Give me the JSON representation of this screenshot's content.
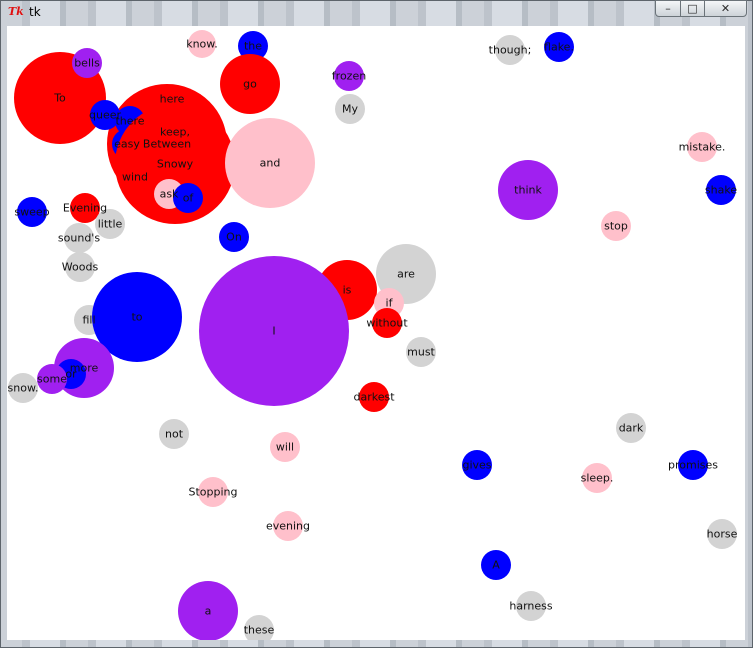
{
  "window": {
    "title": "tk",
    "logo": "Tk",
    "controls": {
      "minimize": "–",
      "maximize": "□",
      "close": "✕"
    }
  },
  "colors": {
    "red": "#ff0000",
    "blue": "#0000ff",
    "purple": "#a020f0",
    "pink": "#ffc0cb",
    "gray": "#d3d3d3"
  },
  "bubbles": [
    {
      "word": "To",
      "color": "red"
    },
    {
      "word": "bells",
      "color": "purple"
    },
    {
      "word": "know.",
      "color": "pink"
    },
    {
      "word": "the",
      "color": "blue"
    },
    {
      "word": "go",
      "color": "red"
    },
    {
      "word": "frozen",
      "color": "purple"
    },
    {
      "word": "My",
      "color": "gray"
    },
    {
      "word": "though;",
      "color": "gray"
    },
    {
      "word": "flake.",
      "color": "blue"
    },
    {
      "word": "here",
      "color": "gray"
    },
    {
      "word": "Between",
      "color": "red"
    },
    {
      "word": "there",
      "color": "blue"
    },
    {
      "word": "keep,",
      "color": "purple"
    },
    {
      "word": "queer",
      "color": "blue"
    },
    {
      "word": "easy",
      "color": "blue"
    },
    {
      "word": "Snowy",
      "color": "red"
    },
    {
      "word": "and",
      "color": "pink"
    },
    {
      "word": "mistake.",
      "color": "pink"
    },
    {
      "word": "wind",
      "color": "red"
    },
    {
      "word": "ask",
      "color": "pink"
    },
    {
      "word": "of",
      "color": "blue"
    },
    {
      "word": "think",
      "color": "purple"
    },
    {
      "word": "shake",
      "color": "blue"
    },
    {
      "word": "sweep",
      "color": "blue"
    },
    {
      "word": "Evening",
      "color": "red"
    },
    {
      "word": "little",
      "color": "gray"
    },
    {
      "word": "sound's",
      "color": "gray"
    },
    {
      "word": "On",
      "color": "blue"
    },
    {
      "word": "stop",
      "color": "pink"
    },
    {
      "word": "Woods",
      "color": "gray"
    },
    {
      "word": "are",
      "color": "gray"
    },
    {
      "word": "is",
      "color": "red"
    },
    {
      "word": "if",
      "color": "pink"
    },
    {
      "word": "without",
      "color": "red"
    },
    {
      "word": "fill",
      "color": "gray"
    },
    {
      "word": "to",
      "color": "blue"
    },
    {
      "word": "I",
      "color": "purple"
    },
    {
      "word": "must",
      "color": "gray"
    },
    {
      "word": "more",
      "color": "purple"
    },
    {
      "word": "or",
      "color": "blue"
    },
    {
      "word": "some",
      "color": "purple"
    },
    {
      "word": "snow.",
      "color": "gray"
    },
    {
      "word": "darkest",
      "color": "red"
    },
    {
      "word": "not",
      "color": "gray"
    },
    {
      "word": "dark",
      "color": "gray"
    },
    {
      "word": "will",
      "color": "pink"
    },
    {
      "word": "gives",
      "color": "blue"
    },
    {
      "word": "sleep.",
      "color": "pink"
    },
    {
      "word": "promises",
      "color": "blue"
    },
    {
      "word": "Stopping",
      "color": "pink"
    },
    {
      "word": "evening",
      "color": "pink"
    },
    {
      "word": "horse",
      "color": "gray"
    },
    {
      "word": "A",
      "color": "blue"
    },
    {
      "word": "harness",
      "color": "gray"
    },
    {
      "word": "a",
      "color": "purple"
    },
    {
      "word": "these",
      "color": "gray"
    }
  ]
}
